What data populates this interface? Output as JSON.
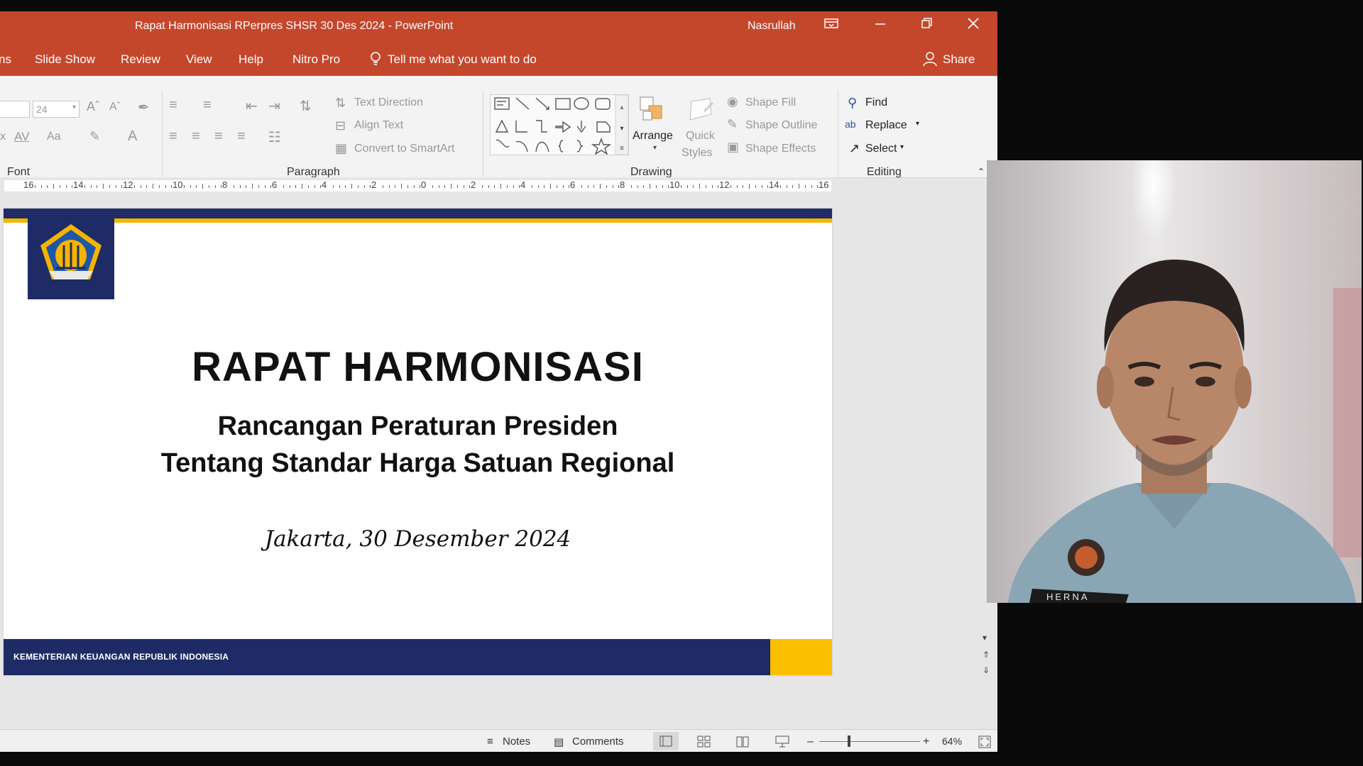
{
  "window": {
    "title": "Rapat Harmonisasi RPerpres SHSR 30 Des 2024  -  PowerPoint",
    "user": "Nasrullah"
  },
  "menu": {
    "partial_tab": "ns",
    "slide_show": "Slide Show",
    "review": "Review",
    "view": "View",
    "help": "Help",
    "nitro": "Nitro Pro",
    "tell_me": "Tell me what you want to do",
    "share": "Share"
  },
  "ribbon": {
    "font_size": "24",
    "font_group": "Font",
    "paragraph_group": "Paragraph",
    "drawing_group": "Drawing",
    "editing_group": "Editing",
    "text_direction": "Text Direction",
    "align_text": "Align Text",
    "convert_smartart": "Convert to SmartArt",
    "arrange": "Arrange",
    "quick_styles_1": "Quick",
    "quick_styles_2": "Styles",
    "shape_fill": "Shape Fill",
    "shape_outline": "Shape Outline",
    "shape_effects": "Shape Effects",
    "find": "Find",
    "replace": "Replace",
    "select": "Select"
  },
  "ruler": {
    "labels": [
      "16",
      "14",
      "12",
      "10",
      "8",
      "6",
      "4",
      "2",
      "0",
      "2",
      "4",
      "6",
      "8",
      "10",
      "12",
      "14",
      "16"
    ]
  },
  "slide": {
    "title": "RAPAT HARMONISASI",
    "subtitle_line1": "Rancangan Peraturan Presiden",
    "subtitle_line2": "Tentang Standar Harga Satuan Regional",
    "date": "Jakarta, 30 Desember 2024",
    "footer": "KEMENTERIAN KEUANGAN REPUBLIK INDONESIA",
    "colors": {
      "navy": "#1e2b66",
      "gold": "#f4b400"
    }
  },
  "status": {
    "notes": "Notes",
    "comments": "Comments",
    "zoom": "64%"
  },
  "webcam": {
    "name_tag": "HERNA"
  },
  "colors": {
    "accent": "#c4472c"
  }
}
